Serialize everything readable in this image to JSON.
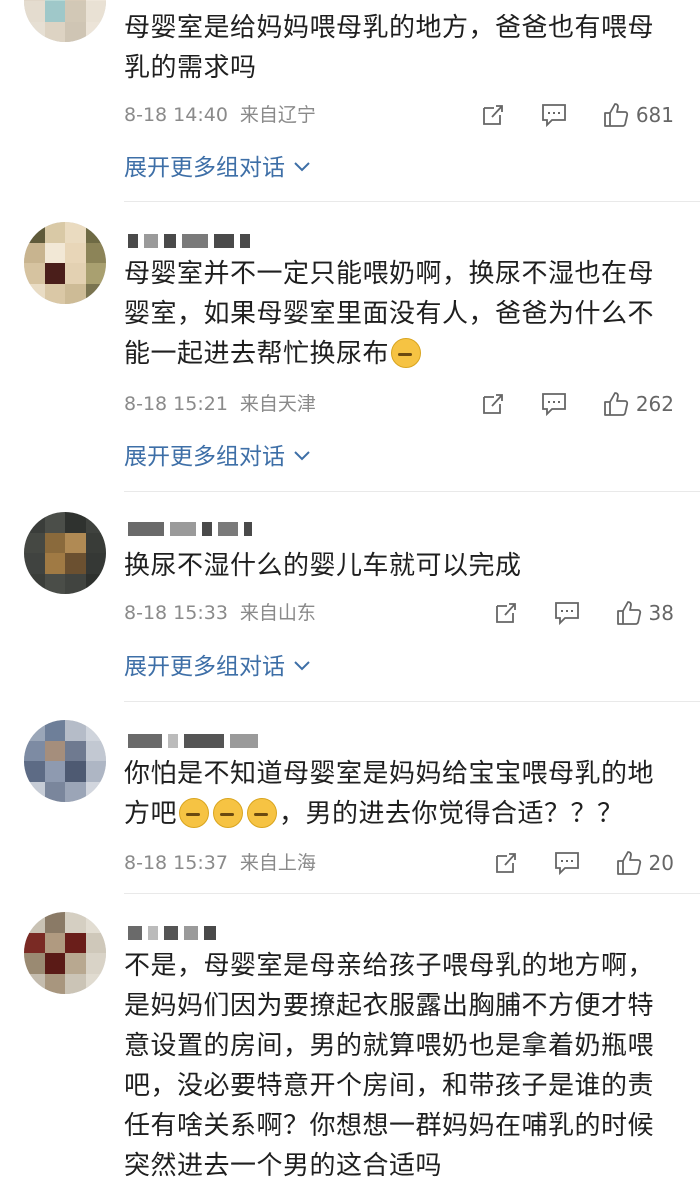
{
  "comments": [
    {
      "text": "母婴室是给妈妈喂母乳的地方，爸爸也有喂母乳的需求吗",
      "time": "8-18 14:40",
      "location": "来自辽宁",
      "likes": "681",
      "expand_label": "展开更多组对话"
    },
    {
      "text": "母婴室并不一定只能喂奶啊，换尿不湿也在母婴室，如果母婴室里面没有人，爸爸为什么不能一起进去帮忙换尿布",
      "time": "8-18 15:21",
      "location": "来自天津",
      "likes": "262",
      "expand_label": "展开更多组对话"
    },
    {
      "text": "换尿不湿什么的婴儿车就可以完成",
      "time": "8-18 15:33",
      "location": "来自山东",
      "likes": "38",
      "expand_label": "展开更多组对话"
    },
    {
      "text_a": "你怕是不知道母婴室是妈妈给宝宝喂母乳的地方吧",
      "text_b": "，男的进去你觉得合适？？？",
      "time": "8-18 15:37",
      "location": "来自上海",
      "likes": "20"
    },
    {
      "text": "不是，母婴室是母亲给孩子喂母乳的地方啊，是妈妈们因为要撩起衣服露出胸脯不方便才特意设置的房间，男的就算喂奶也是拿着奶瓶喂吧，没必要特意开个房间，和带孩子是谁的责任有啥关系啊？你想想一群妈妈在哺乳的时候突然进去一个男的这合适吗"
    }
  ],
  "colors": {
    "link": "#3e6fa7",
    "meta": "#8a8a8a",
    "divider": "#e9e9e9"
  },
  "icons": [
    "share-icon",
    "comment-icon",
    "thumbs-up-icon",
    "chevron-down-icon",
    "laughing-crying-emoji",
    "awkward-emoji"
  ]
}
